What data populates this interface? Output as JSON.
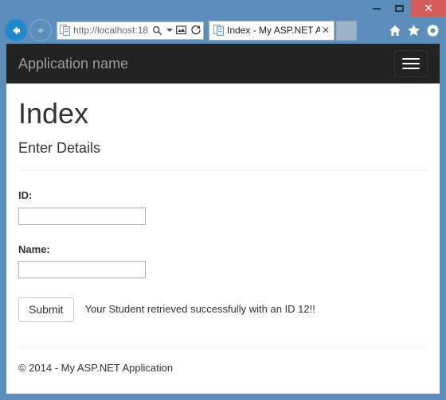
{
  "browser": {
    "window_controls": {
      "minimize_label": "–",
      "maximize_label": "□",
      "close_label": "✕"
    },
    "back_tooltip": "Back",
    "forward_tooltip": "Forward",
    "address": {
      "url_scheme_host": "http://",
      "url_host": "localhost",
      "url_rest": ":18…",
      "full_text": "http://localhost:18…"
    },
    "address_icons": [
      "search-icon",
      "dropdown-caret-icon",
      "compatibility-view-icon",
      "refresh-icon"
    ],
    "tab": {
      "title": "Index - My ASP.NET A...",
      "close_label": "✕"
    },
    "newtab_label": "",
    "chrome_icons": [
      "home-icon",
      "favorites-star-icon",
      "tools-gear-icon"
    ]
  },
  "page": {
    "navbar": {
      "brand": "Application name",
      "toggle_label": "Toggle navigation"
    },
    "title": "Index",
    "subtitle": "Enter Details",
    "form": {
      "fields": [
        {
          "label": "ID:",
          "value": "",
          "placeholder": "",
          "name": "id-field"
        },
        {
          "label": "Name:",
          "value": "",
          "placeholder": "",
          "name": "name-field"
        }
      ],
      "submit_label": "Submit",
      "result_message": "Your Student retrieved successfully with an ID 12!!"
    },
    "footer": {
      "text": "© 2014 - My ASP.NET Application"
    }
  },
  "colors": {
    "window_frame": "#5b8ebb",
    "close_button": "#d65c5c",
    "navbar_bg": "#222222",
    "navbar_brand_text": "#9d9d9d",
    "back_button_blue": "#2288cc",
    "page_text": "#333333"
  }
}
